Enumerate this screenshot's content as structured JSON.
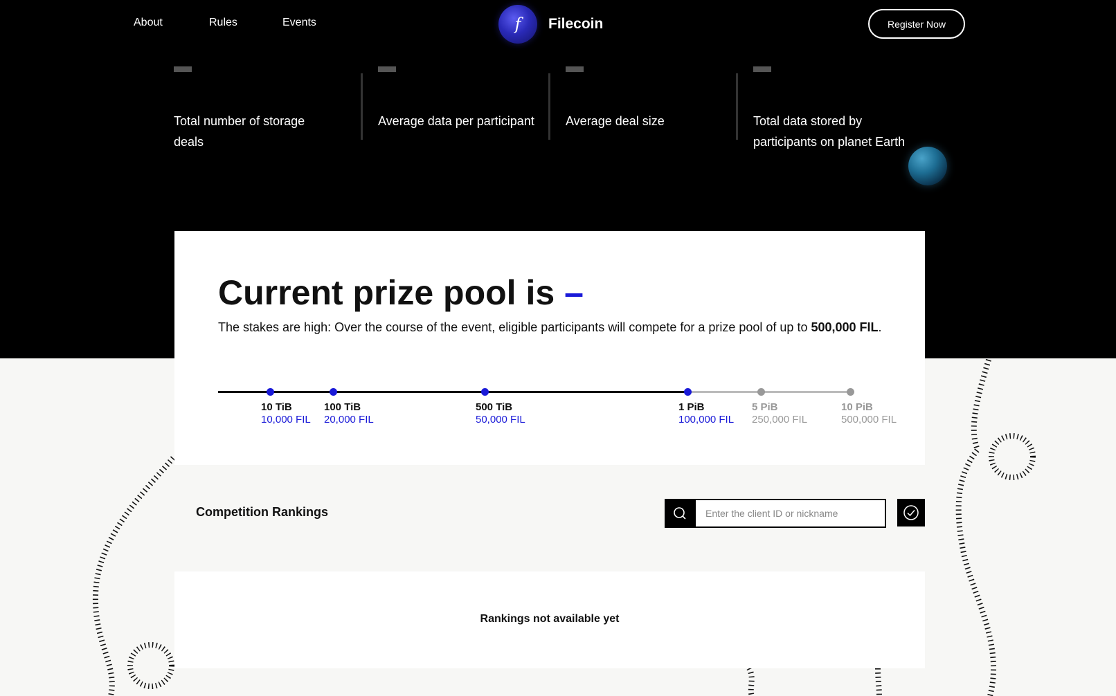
{
  "nav": {
    "links": [
      "About",
      "Rules",
      "Events"
    ],
    "brand": "Filecoin",
    "brand_logo_glyph": "f",
    "register_label": "Register Now"
  },
  "stats": [
    {
      "value": "—",
      "label": "Total number of storage deals"
    },
    {
      "value": "—",
      "label": "Average data per participant"
    },
    {
      "value": "—",
      "label": "Average deal size"
    },
    {
      "value": "—",
      "label": "Total data stored by participants on planet Earth"
    }
  ],
  "prize": {
    "title": "Current prize pool is",
    "title_value": "–",
    "desc_before": "The stakes are high: Over the course of the event, eligible participants will compete for a prize pool of up to",
    "desc_strong": "500,000 FIL",
    "desc_after": ".",
    "milestones": [
      {
        "size": "10 TiB",
        "fil": "10,000 FIL",
        "reached": true
      },
      {
        "size": "100 TiB",
        "fil": "20,000 FIL",
        "reached": true
      },
      {
        "size": "500 TiB",
        "fil": "50,000 FIL",
        "reached": true
      },
      {
        "size": "1 PiB",
        "fil": "100,000 FIL",
        "reached": true
      },
      {
        "size": "5 PiB",
        "fil": "250,000 FIL",
        "reached": false
      },
      {
        "size": "10 PiB",
        "fil": "500,000 FIL",
        "reached": false
      }
    ]
  },
  "rankings": {
    "title": "Competition Rankings",
    "search_placeholder": "Enter the client ID or nickname",
    "empty_message": "Rankings not available yet"
  },
  "colors": {
    "accent": "#1a1ad8",
    "inactive": "#999999",
    "background_dark": "#000000",
    "background_light": "#f7f7f5"
  }
}
